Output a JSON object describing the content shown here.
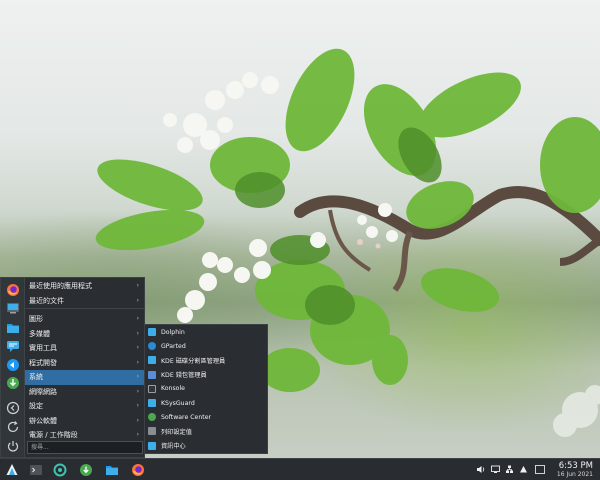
{
  "launcher": {
    "categories": [
      {
        "label": "最近使用的應用程式",
        "active": false
      },
      {
        "label": "最近的文件",
        "active": false
      },
      {
        "label": "圖形",
        "active": false
      },
      {
        "label": "多媒體",
        "active": false
      },
      {
        "label": "實用工具",
        "active": false
      },
      {
        "label": "程式開發",
        "active": false
      },
      {
        "label": "系統",
        "active": true
      },
      {
        "label": "網際網路",
        "active": false
      },
      {
        "label": "設定",
        "active": false
      },
      {
        "label": "辦公軟體",
        "active": false
      },
      {
        "label": "電源 / 工作階段",
        "active": false
      }
    ],
    "arrow_glyph": "›",
    "search": {
      "placeholder": "搜尋..."
    },
    "favorites": [
      "firefox-icon",
      "system-settings-icon",
      "files-icon",
      "chat-icon",
      "discover-icon",
      "download-icon"
    ],
    "session_buttons": [
      "logout-icon",
      "restart-icon",
      "shutdown-icon"
    ]
  },
  "submenu": {
    "items": [
      {
        "label": "Dolphin",
        "icon": "folder-icon",
        "color": "#3daee9"
      },
      {
        "label": "GParted",
        "icon": "partition-icon",
        "color": "#2b8bd6"
      },
      {
        "label": "KDE 磁碟分割區管理員",
        "icon": "disk-icon",
        "color": "#3daee9"
      },
      {
        "label": "KDE 錢包管理員",
        "icon": "wallet-icon",
        "color": "#5a8fd8"
      },
      {
        "label": "Konsole",
        "icon": "terminal-icon",
        "color": "#31363b"
      },
      {
        "label": "KSysGuard",
        "icon": "monitor-icon",
        "color": "#3daee9"
      },
      {
        "label": "Software Center",
        "icon": "software-center-icon",
        "color": "#4aa84f"
      },
      {
        "label": "列印設定值",
        "icon": "printer-icon",
        "color": "#888e93"
      },
      {
        "label": "資訊中心",
        "icon": "info-center-icon",
        "color": "#3daee9"
      }
    ]
  },
  "taskbar": {
    "pinned": [
      "application-launcher-icon",
      "terminal-icon",
      "system-monitor-icon",
      "download-manager-icon",
      "file-manager-icon",
      "firefox-icon"
    ],
    "tray": [
      "volume-icon",
      "display-icon",
      "network-icon",
      "notifications-icon"
    ],
    "clock": {
      "time": "6:53 PM",
      "date": "16 Jun 2021"
    }
  },
  "colors": {
    "accent": "#3daee9",
    "highlight": "#2f6da3",
    "panel": "#292c30"
  }
}
